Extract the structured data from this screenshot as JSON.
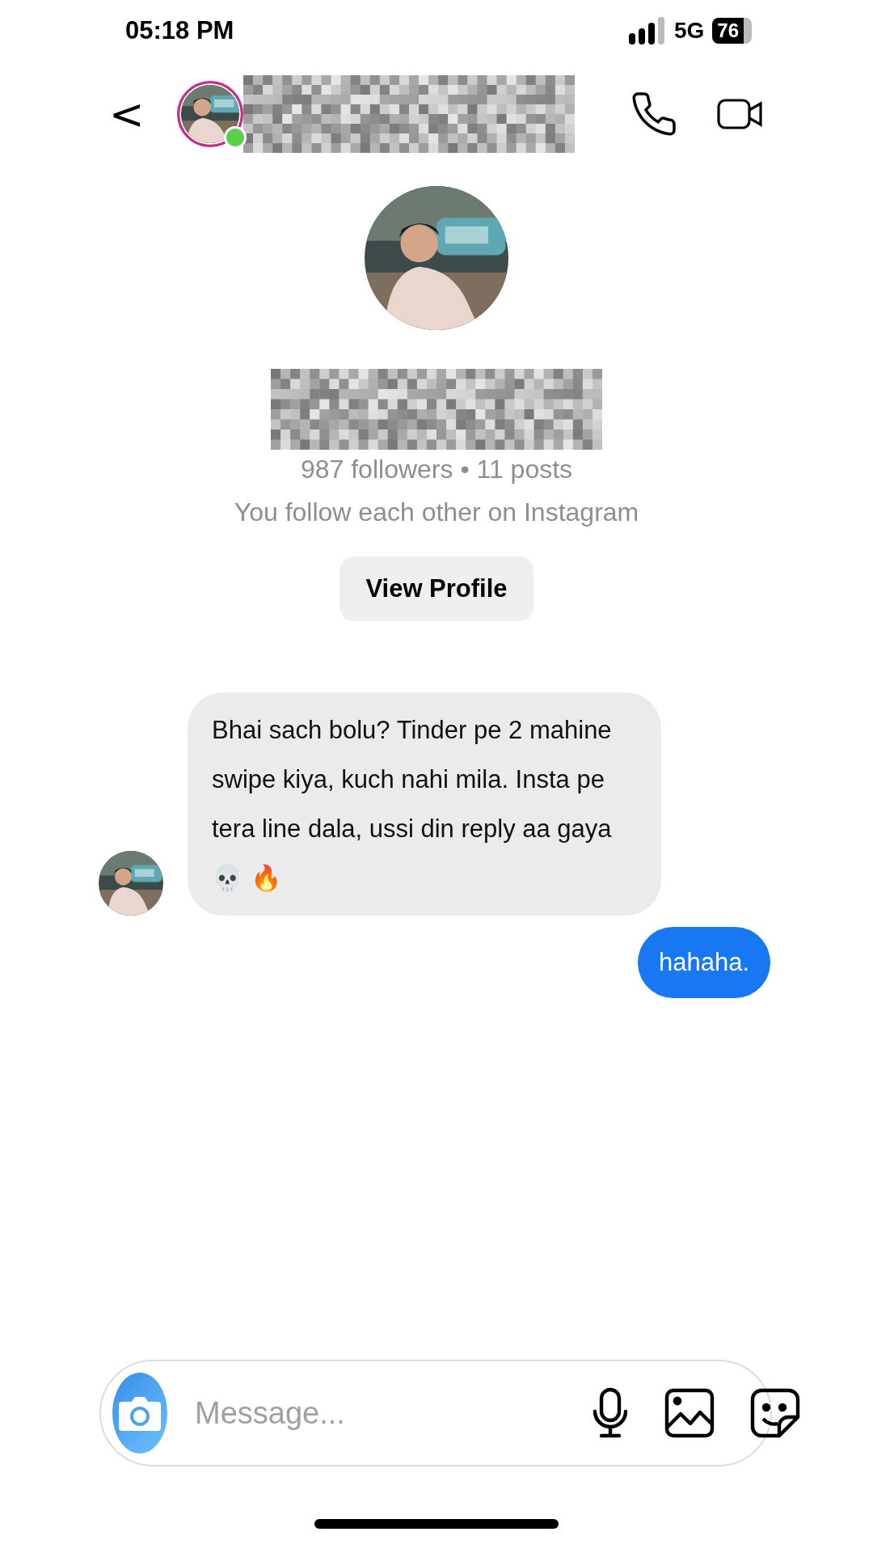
{
  "status_bar": {
    "time": "05:18 PM",
    "network": "5G",
    "battery": "76"
  },
  "header": {
    "back": "<",
    "online": true
  },
  "profile": {
    "stats": "987 followers • 11 posts",
    "mutual": "You follow each other on Instagram",
    "button": "View Profile"
  },
  "messages": [
    {
      "kind": "incoming",
      "text": "Bhai sach bolu? Tinder pe 2 mahine swipe kiya, kuch nahi mila. Insta pe tera line dala, ussi din reply aa gaya 💀 🔥"
    },
    {
      "kind": "outgoing",
      "text": "hahaha."
    }
  ],
  "composer": {
    "placeholder": "Message..."
  }
}
